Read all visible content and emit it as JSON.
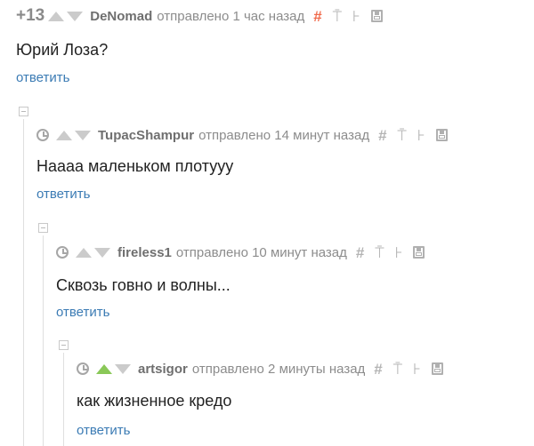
{
  "comments": [
    {
      "score": "+13",
      "author": "DeNomad",
      "meta": "отправлено 1 час назад",
      "text": "Юрий Лоза?",
      "reply": "ответить",
      "upvoted": false,
      "hash_accent": true
    },
    {
      "author": "TupacShampur",
      "meta": "отправлено 14 минут назад",
      "text": "Haaaa маленьком плотууу",
      "reply": "ответить",
      "upvoted": false
    },
    {
      "author": "fireless1",
      "meta": "отправлено 10 минут назад",
      "text": "Сквозь говно и волны...",
      "reply": "ответить",
      "upvoted": false
    },
    {
      "author": "artsigor",
      "meta": "отправлено 2 минуты назад",
      "text": "как жизненное кредо",
      "reply": "ответить",
      "upvoted": true
    }
  ],
  "icons": {
    "hash": "#",
    "link": "⍑",
    "branch": "⊦"
  },
  "colors": {
    "accent_hash": "#f06b4c",
    "upvote_active": "#8ac858",
    "link": "#3b7bb4"
  }
}
